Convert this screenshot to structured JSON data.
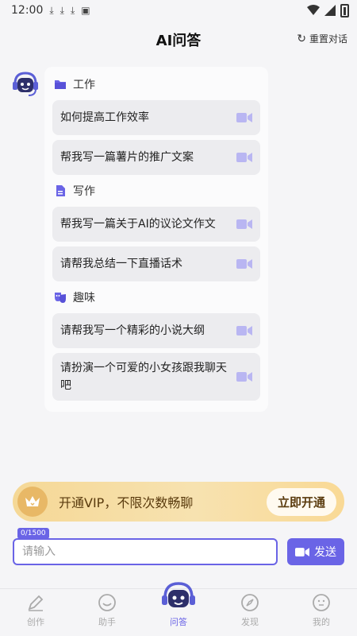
{
  "status_bar": {
    "time": "12:00"
  },
  "header": {
    "title": "AI问答",
    "reset_label": "重置对话"
  },
  "categories": [
    {
      "name": "工作",
      "icon": "folder-icon",
      "items": [
        "如何提高工作效率",
        "帮我写一篇薯片的推广文案"
      ]
    },
    {
      "name": "写作",
      "icon": "document-icon",
      "items": [
        "帮我写一篇关于AI的议论文作文",
        "请帮我总结一下直播话术"
      ]
    },
    {
      "name": "趣味",
      "icon": "mask-icon",
      "items": [
        "请帮我写一个精彩的小说大纲",
        "请扮演一个可爱的小女孩跟我聊天吧"
      ]
    }
  ],
  "vip": {
    "text": "开通VIP，不限次数畅聊",
    "button": "立即开通"
  },
  "input": {
    "counter": "0/1500",
    "placeholder": "请输入",
    "send_label": "发送"
  },
  "tabs": [
    {
      "label": "创作",
      "icon": "pencil-icon"
    },
    {
      "label": "助手",
      "icon": "smile-icon"
    },
    {
      "label": "问答",
      "icon": "robot-icon"
    },
    {
      "label": "发现",
      "icon": "compass-icon"
    },
    {
      "label": "我的",
      "icon": "profile-icon"
    }
  ],
  "colors": {
    "accent": "#6a64e6",
    "vip_gold": "#f5d896"
  }
}
